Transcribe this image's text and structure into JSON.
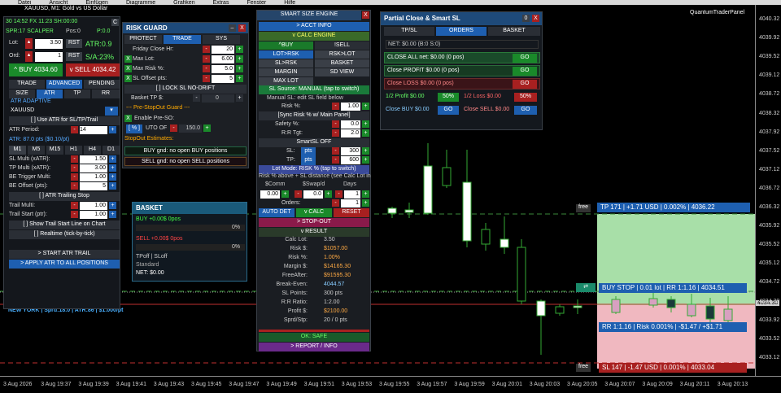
{
  "menubar": {
    "items": [
      "Datei",
      "Ansicht",
      "Einfügen",
      "Diagramme",
      "Grafiken",
      "Extras",
      "Fenster",
      "Hilfe"
    ]
  },
  "chart": {
    "title": "XAUUSD, M1: Gold vs US Dollar",
    "panel_brand": "QuantumTraderPanel",
    "y_labels": [
      "4040.32",
      "4039.92",
      "4039.52",
      "4039.12",
      "4038.72",
      "4038.32",
      "4037.92",
      "4037.52",
      "4037.12",
      "4036.72",
      "4036.32",
      "4035.92",
      "4035.52",
      "4035.12",
      "4034.72",
      "4034.30",
      "4033.92",
      "4033.52",
      "4033.12"
    ],
    "x_labels": [
      "3 Aug 2026",
      "3 Aug 19:37",
      "3 Aug 19:39",
      "3 Aug 19:41",
      "3 Aug 19:43",
      "3 Aug 19:45",
      "3 Aug 19:47",
      "3 Aug 19:49",
      "3 Aug 19:51",
      "3 Aug 19:53",
      "3 Aug 19:55",
      "3 Aug 19:57",
      "3 Aug 19:59",
      "3 Aug 20:01",
      "3 Aug 20:03",
      "3 Aug 20:05",
      "3 Aug 20:07",
      "3 Aug 20:09",
      "3 Aug 20:11",
      "3 Aug 20:13"
    ],
    "tp_line": "TP 171 | +1.71 USD | 0.002% | 4036.22",
    "buystop_line": "BUY STOP | 0.01 lot | RR 1:1.16 | 4034.51",
    "rr_line": "RR 1:1.16 | Risk 0.001% | -$1.47 / +$1.71",
    "sl_line": "SL 147 | -1.47 USD | 0.001% | 4033.04",
    "free": "free",
    "price_tag": "4034.30",
    "status": "NEW YORK | Sprd:18.0 | ATR:86 | $1.000/pt"
  },
  "left": {
    "stats": [
      "30 14:52",
      "FX 11:23",
      "SH:00:00"
    ],
    "spr": "SPR:17 SCALPER",
    "pos": "Pos:0",
    "pnl": "P:0.0",
    "lot_label": "Lot:",
    "lot": "3.50",
    "rst": "RST",
    "atr": "ATR:0.9",
    "ord_label": "Ord:",
    "ord": "1",
    "sa": "S/A:23%",
    "buy": "^ BUY 4034.60",
    "sell": "v SELL 4034.42",
    "tabs": [
      "TRADE",
      "ADVANCED",
      "PENDING"
    ],
    "tabs2": [
      "SIZE",
      "ATR",
      "TP",
      "RR"
    ],
    "atr_adaptive": "ATR ADAPTIVE",
    "symbol": "XAUUSD",
    "use_atr": "[ ] Use ATR for SL/TP/Trail",
    "atr_period_lbl": "ATR Period:",
    "atr_period": "14",
    "atr_info": "ATR: 87.0 pts ($0.10/pt)",
    "tfs": [
      "M1",
      "M5",
      "M15",
      "H1",
      "H4",
      "D1"
    ],
    "sl_multi_lbl": "SL Multi (xATR):",
    "sl_multi": "1.50",
    "tp_multi_lbl": "TP Multi (xATR):",
    "tp_multi": "3.00",
    "be_lbl": "BE Trigger Multi:",
    "be": "1.00",
    "beoff_lbl": "BE Offset (pts):",
    "beoff": "5",
    "trail_toggle": "[ ] ATR Trailing Stop",
    "trail_multi_lbl": "Trail Multi:",
    "trail_multi": "1.00",
    "trail_start_lbl": "Trail Start (ptr):",
    "trail_start": "1.00",
    "show_trail": "[ ] Show Trail Start Line on Chart",
    "realtime": "[ ] Realtime (tick-by-tick)",
    "start_atr": "> START ATR TRAIL",
    "apply_atr": "> APPLY ATR TO ALL POSITIONS"
  },
  "risk": {
    "title": "RISK GUARD",
    "tabs": [
      "PROTECT",
      "TRADE",
      "SYS"
    ],
    "friday_lbl": "Friday Close Hr:",
    "friday": "20",
    "maxlot_lbl": "Max Lot:",
    "maxlot": "6.00",
    "maxrisk_lbl": "Max Risk %:",
    "maxrisk": "5.0",
    "sloff_lbl": "SL Offset pts:",
    "sloff": "5",
    "lock": "[ ] LOCK SL NO-DRIFT",
    "basket_lbl": "Basket TP $:",
    "basket": "0",
    "pre_title": "--- Pre-StopOut Guard ---",
    "enable_pre": "Enable Pre-SO:",
    "pct": "[ % ]",
    "uto": "UTO OF",
    "uto_val": "150.0",
    "est_title": "StopOut Estimates:",
    "buy_est": "BUY gnd: no open BUY positions",
    "sell_est": "SELL gnd: no open SELL positions"
  },
  "basket": {
    "title": "BASKET",
    "buy": "BUY +0.00$ 0pos",
    "buy_pct": "0%",
    "sell": "SELL +0.00$ 0pos",
    "sell_pct": "0%",
    "tp": "TPoff | SLoff",
    "mode": "Standard",
    "net": "NET: $0.00"
  },
  "sse": {
    "title": "SMART SIZE ENGINE",
    "acct": "> ACCT INFO",
    "calc": "v CALC ENGINE",
    "buy": "^BUY",
    "sell": "!SELL",
    "lotrsk": "LOT>RSK",
    "rsklot": "RSK>LOT",
    "slrsk": "SL>RSK",
    "basket": "BASKET",
    "margin": "MARGIN",
    "sdview": "SD VIEW",
    "maxlot": "MAX LOT",
    "sl_source": "SL Source: MANUAL (tap to switch)",
    "manual_sl": "Manual SL: edit SL field below",
    "risk_lbl": "Risk %:",
    "risk": "1.00",
    "sync": "[Sync Risk % w/ Main Panel]",
    "safety_lbl": "Safety %:",
    "safety": "0.0",
    "rr_lbl": "R:R Tgt:",
    "rr": "2.0",
    "smartsl": "SmartSL OFF",
    "sl_lbl": "SL:",
    "sl_unit": "pts",
    "sl": "300",
    "tp_lbl": "TP:",
    "tp": "600",
    "lotmode": "Lot Mode: RISK % (tap to switch)",
    "risk_above": "Risk % above + SL distance (see Calc Lot in",
    "cols": [
      "$Comm",
      "$Swap/d",
      "Days"
    ],
    "comm": "0.00",
    "swap": "0.0",
    "days": "1",
    "orders_lbl": "Orders:",
    "orders": "1",
    "autodet": "AUTO DET",
    "vcalc": "v CALC",
    "reset": "RESET",
    "stopout": "> STOP-OUT",
    "result": "v RESULT",
    "results": [
      [
        "Calc Lot:",
        "3.50"
      ],
      [
        "Risk $:",
        "$1057.00"
      ],
      [
        "Risk %:",
        "1.00%"
      ],
      [
        "Margin $:",
        "$14165.30"
      ],
      [
        "FreeAfter:",
        "$91595.30"
      ],
      [
        "Break-Even:",
        "4044.57"
      ],
      [
        "SL Points:",
        "300 pts"
      ],
      [
        "R:R Ratio:",
        "1:2.00"
      ],
      [
        "Profit $:",
        "$2100.00"
      ],
      [
        "Sprd/Stp:",
        "20 / 0 pts"
      ]
    ],
    "ok": "OK: SAFE",
    "report": "> REPORT / INFO"
  },
  "partial": {
    "title": "Partial Close & Smart SL",
    "tabs": [
      "TP/SL",
      "ORDERS",
      "BASKET"
    ],
    "net": "NET: $0.00 (B:0 S:0)",
    "close_all": "CLOSE ALL net: $0.00 (0 pos)",
    "close_profit": "Close PROFIT $0.00 (0 pos)",
    "close_loss": "Close LOSS $0.00 (0 pos)",
    "go": "GO",
    "half_profit": "1/2 Profit $0.00",
    "pct50": "50%",
    "half_loss": "1/2 Loss $0.00",
    "close_buy": "Close BUY $0.00",
    "close_sell": "Close SELL $0.00"
  }
}
